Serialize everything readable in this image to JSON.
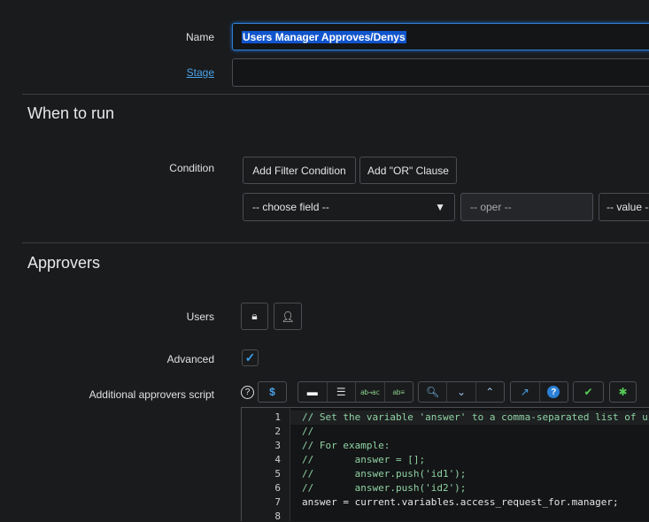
{
  "form": {
    "name_label": "Name",
    "name_value": "Users Manager Approves/Denys",
    "stage_label": "Stage",
    "stage_value": ""
  },
  "when_to_run": {
    "heading": "When to run",
    "condition_label": "Condition",
    "add_filter": "Add Filter Condition",
    "add_or": "Add \"OR\" Clause",
    "choose_field": "-- choose field --",
    "oper": "-- oper --",
    "value": "-- value --"
  },
  "approvers": {
    "heading": "Approvers",
    "users_label": "Users",
    "advanced_label": "Advanced",
    "advanced_checked": true,
    "script_label": "Additional approvers script"
  },
  "toolbar": {
    "icons": [
      "script-include-icon",
      "comment-icon",
      "format-icon",
      "replace-icon",
      "replace-all-icon",
      "search-icon",
      "collapse-icon",
      "expand-icon",
      "fullscreen-icon",
      "help-icon",
      "syntax-check-icon",
      "debug-icon"
    ],
    "replace_text": "ab→ac"
  },
  "editor": {
    "lines": [
      {
        "n": "1",
        "text": "// Set the variable 'answer' to a comma-separated list of us",
        "comment": true
      },
      {
        "n": "2",
        "text": "//",
        "comment": true
      },
      {
        "n": "3",
        "text": "// For example:",
        "comment": true
      },
      {
        "n": "4",
        "text": "//       answer = [];",
        "comment": true
      },
      {
        "n": "5",
        "text": "//       answer.push('id1');",
        "comment": true
      },
      {
        "n": "6",
        "text": "//       answer.push('id2');",
        "comment": true
      },
      {
        "n": "7",
        "text": "answer = current.variables.access_request_for.manager;",
        "comment": false
      },
      {
        "n": "8",
        "text": "",
        "comment": false
      }
    ]
  }
}
